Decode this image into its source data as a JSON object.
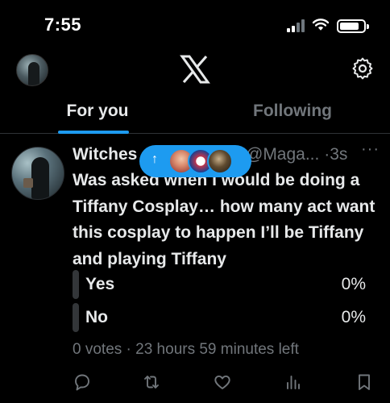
{
  "status_bar": {
    "time": "7:55",
    "signal_bars_active": 2,
    "icons": [
      "cellular-signal-icon",
      "wifi-icon",
      "battery-icon"
    ]
  },
  "header": {
    "logo": "x-logo-icon",
    "settings_icon": "gear-icon"
  },
  "tabs": [
    {
      "label": "For you",
      "active": true
    },
    {
      "label": "Following",
      "active": false
    }
  ],
  "new_posts_pill": {
    "icon": "arrow-up-icon"
  },
  "tweet": {
    "display_name": "Witches",
    "handle": "@Maga...",
    "separator": "·",
    "time": "3s",
    "more": "···",
    "text": "Was asked when I would be doing a Tiffany Cosplay… how many act want this cosplay to happen I’ll be Tiffany and playing Tiffany",
    "poll": {
      "options": [
        {
          "label": "Yes",
          "percent": "0%"
        },
        {
          "label": "No",
          "percent": "0%"
        }
      ],
      "meta": "0 votes · 23 hours 59 minutes left"
    },
    "actions": [
      "reply-icon",
      "repost-icon",
      "like-icon",
      "views-icon",
      "bookmark-icon"
    ]
  },
  "colors": {
    "background": "#000000",
    "accent": "#1d9bf0",
    "text_primary": "#e7e9ea",
    "text_secondary": "#71767b",
    "divider": "#2f3336"
  }
}
